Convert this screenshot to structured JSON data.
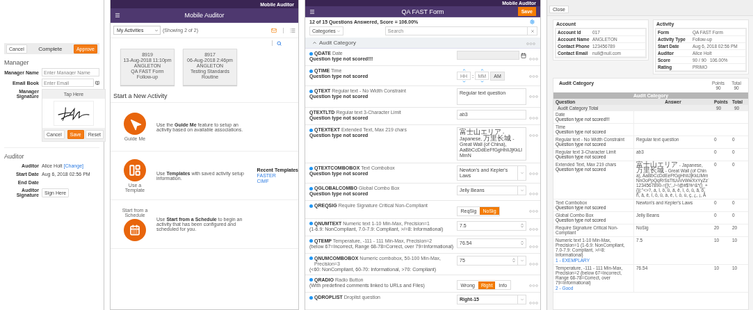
{
  "complete_screen": {
    "toolbar": {
      "cancel": "Cancel",
      "title": "Complete",
      "approve": "Approve"
    },
    "manager": {
      "heading": "Manager",
      "fields": [
        {
          "label": "Manager Name",
          "placeholder": "Enter Manager Name",
          "kind": "text"
        },
        {
          "label": "Email Book",
          "placeholder": "Enter Email",
          "kind": "book"
        }
      ],
      "signature": {
        "label": "Manager Signature",
        "prompt": "Tap Here",
        "buttons": [
          {
            "label": "Cancel",
            "primary": false
          },
          {
            "label": "Save",
            "primary": true
          },
          {
            "label": "Reset",
            "primary": false
          }
        ]
      }
    },
    "auditor": {
      "heading": "Auditor",
      "rows": [
        {
          "label": "Auditor",
          "value": "Alice Holt",
          "link": "[Change]"
        },
        {
          "label": "Start Date",
          "value": "Aug 6, 2018 02:56 PM"
        },
        {
          "label": "End Date"
        },
        {
          "label": "Auditor Signature",
          "button": "Sign Here"
        }
      ]
    }
  },
  "activities_screen": {
    "status_bar": "Mobile Auditor",
    "title": "Mobile Auditor",
    "filter": "My Activities",
    "showing": "(Showing 2 of 2)",
    "activities": [
      {
        "lines": [
          "8919",
          "13-Aug-2018 11:10pm",
          "ANGLETON",
          "QA FAST Form",
          "Follow-up"
        ]
      },
      {
        "lines": [
          "8917",
          "06-Aug-2018 2:46pm",
          "ANGLETON",
          "Testing Standards",
          "Routine"
        ]
      }
    ],
    "new_heading": "Start a New Activity",
    "options": [
      {
        "kind": "guide",
        "label": "Guide Me",
        "description": "Use the **Guide Me** feature to setup an activity based on available associations."
      },
      {
        "kind": "template",
        "label": "Use a Template",
        "description": "Use **Templates** with saved activity setup information.",
        "recent": {
          "heading": "Recent Templates",
          "links": [
            "FASTER",
            "CIMF"
          ]
        }
      },
      {
        "kind": "schedule",
        "label": "Start from a Schedule",
        "description": "Use **Start from a Schedule** to begin an activity that has been configured and scheduled for you."
      }
    ]
  },
  "form_screen": {
    "status_bar": "Mobile Auditor",
    "title": "QA FAST Form",
    "save": "Save",
    "summary": "12 of 15 Questions Answered, Score = 106.00%",
    "categories": "Categories",
    "search_placeholder": "Search",
    "category": {
      "title": "Audit Category",
      "expanded": true
    },
    "questions": [
      {
        "code": "QDATE",
        "text": "Date",
        "note": "Question type not scored!!!",
        "dot": true,
        "kind": "date"
      },
      {
        "code": "QTIME",
        "text": "Time",
        "note": "Question type not scored",
        "dot": true,
        "kind": "time",
        "hour_placeholder": "HH",
        "minute_placeholder": "MM",
        "separator": ":",
        "period": "AM"
      },
      {
        "code": "QTEXT",
        "text": "Regular text - No Width Constraint",
        "note": "Question type not scored",
        "dot": true,
        "kind": "textarea",
        "value": "Regular text question"
      },
      {
        "code": "QTEXTLTD",
        "text": "Regular text 3-Character Limit",
        "note": "Question type not scored",
        "dot": false,
        "kind": "text",
        "value": "ab3"
      },
      {
        "code": "QTEXTEXT",
        "text": "Extended Text, Max 219 chars",
        "note": "Question type not scored",
        "dot": true,
        "kind": "textarea",
        "value": "富士山エリア - Japanese, 万里长城 - Great Wall (of China), AaBbCcDdEeFfGgHhIiJjKkLlMmN"
      },
      {
        "code": "QTEXTCOMBOBOX",
        "text": "Text Combobox",
        "note": "Question type not scored",
        "dot": true,
        "kind": "combo",
        "value": "Newton's and Kepler's Laws"
      },
      {
        "code": "QGLOBALCOMBO",
        "text": "Global Combo Box",
        "note": "Question type not scored",
        "dot": true,
        "kind": "combo",
        "value": "Jelly Beans"
      },
      {
        "code": "QREQSIG",
        "text": "Require Signature Critical Non-Compliant",
        "dot": true,
        "kind": "choice",
        "options": [
          {
            "label": "ReqSig",
            "selected": false
          },
          {
            "label": "NoSig",
            "selected": true
          }
        ]
      },
      {
        "code": "QNUMTEXT",
        "text": "Numeric text 1-10 Min-Max, Precision=1",
        "detail": "(1-6.9: NonCompliant, 7.0-7.9: Compliant, >/=8: Informational)",
        "dot": true,
        "kind": "number",
        "value": "7.5"
      },
      {
        "code": "QTEMP",
        "text": "Temperature, -111 - 111 Min-Max, Precision=2",
        "detail": "(below 67=Incorrect, Range 68-78=Correct, over 79=Informational)",
        "dot": true,
        "kind": "number",
        "value": "76.54"
      },
      {
        "code": "QNUMCOMBOBOX",
        "text": "Numeric combobox, 50-100 Min-Max, Precision=3",
        "detail": "(<60: NonCompliant, 60-70: Informational, >70: Compliant)",
        "dot": true,
        "kind": "numcombo",
        "value": "75"
      },
      {
        "code": "QRADIO",
        "text": "Radio Button",
        "detail": "(With predefined comments linked to URLs and Files)",
        "dot": true,
        "kind": "choice",
        "options": [
          {
            "label": "Wrong",
            "selected": false
          },
          {
            "label": "Right",
            "selected": true
          },
          {
            "label": "Info",
            "selected": false
          }
        ]
      },
      {
        "code": "QDROPLIST",
        "text": "Droplist question",
        "dot": true,
        "kind": "select",
        "value": "Right-15"
      }
    ]
  },
  "report_screen": {
    "close": "Close",
    "account": {
      "title": "Account",
      "rows": [
        {
          "label": "Account Id",
          "values": [
            "017"
          ]
        },
        {
          "label": "Account Name",
          "values": [
            "ANGLETON"
          ]
        },
        {
          "label": "Contact Phone",
          "values": [
            "123456789"
          ]
        },
        {
          "label": "Contact Email",
          "values": [
            "null@null.com"
          ]
        }
      ]
    },
    "activity": {
      "title": "Activity",
      "rows": [
        {
          "label": "Form",
          "values": [
            "QA FAST Form"
          ]
        },
        {
          "label": "Activity Type",
          "values": [
            "Follow-up"
          ]
        },
        {
          "label": "Start Date",
          "values": [
            "Aug 6, 2018 02:56 PM"
          ]
        },
        {
          "label": "Auditor",
          "values": [
            "Alice Holt"
          ]
        },
        {
          "label": "Score",
          "values": [
            "90 / 90",
            "106.00%"
          ]
        },
        {
          "label": "Rating",
          "values": [
            "PRIMO"
          ]
        }
      ]
    },
    "category": {
      "title": "Audit Category",
      "totals": [
        {
          "label": "Points",
          "value": "90"
        },
        {
          "label": "Total",
          "value": "90"
        }
      ]
    },
    "table": {
      "title": "Audit Category",
      "columns": [
        "Question",
        "Answer",
        "Points",
        "Total"
      ],
      "total_row": {
        "label": "Audit Category Total",
        "points": "90",
        "total": "90"
      },
      "rows": [
        {
          "question": "Date",
          "note": "Question type not scored!!!"
        },
        {
          "question": "Time",
          "note": "Question type not scored"
        },
        {
          "question": "Regular text - No Width Constraint",
          "note": "Question type not scored",
          "answer": "Regular text question",
          "points": "0",
          "total": "0"
        },
        {
          "question": "Regular text 3-Character Limit",
          "note": "Question type not scored",
          "answer": "ab3",
          "points": "0",
          "total": "0"
        },
        {
          "question": "Extended Text, Max 219 chars",
          "note": "Question type not scored",
          "answer": "富士山エリア - Japanese, 万里长城 - Great Wall (of China), AaBbCcDdEeFfGgHhIiJjKkLlMmNnOoPpQqRrSsTtUuVvWwXxYyZz`1234567890-=[]\\;',./~!@#$%^&*()_+{}|:\"<>?, á, î, ö, û, ä, ë, ï, ö, ü, ã, õ, ñ, â, ê, î, ô, û, à, è, ì, ò, ù, ç, ¿, ¡, Å",
          "points": "0",
          "total": "0"
        },
        {
          "question": "Text Combobox",
          "note": "Question type not scored",
          "answer": "Newton's and Kepler's Laws",
          "points": "0",
          "total": "0"
        },
        {
          "question": "Global Combo Box",
          "note": "Question type not scored",
          "answer": "Jelly Beans",
          "points": "0",
          "total": "0"
        },
        {
          "question": "Require Signature Critical Non-Compliant",
          "answer": "NoSig",
          "points": "20",
          "total": "20"
        },
        {
          "question": "Numeric text 1-10 Min-Max, Precision=1 (1-6.9: NonCompliant, 7.0-7.9: Compliant, >/=8: Informational)",
          "answer": "7.5",
          "points": "10",
          "total": "10",
          "link": "1 - EXEMPLARY"
        },
        {
          "question": "Temperature, -111 - 111 Min-Max, Precision=2 (below 67=Incorrect, Range 68-78=Correct, over 79=Informational)",
          "answer": "76.54",
          "points": "10",
          "total": "10",
          "link": "2 - Good"
        }
      ]
    }
  }
}
